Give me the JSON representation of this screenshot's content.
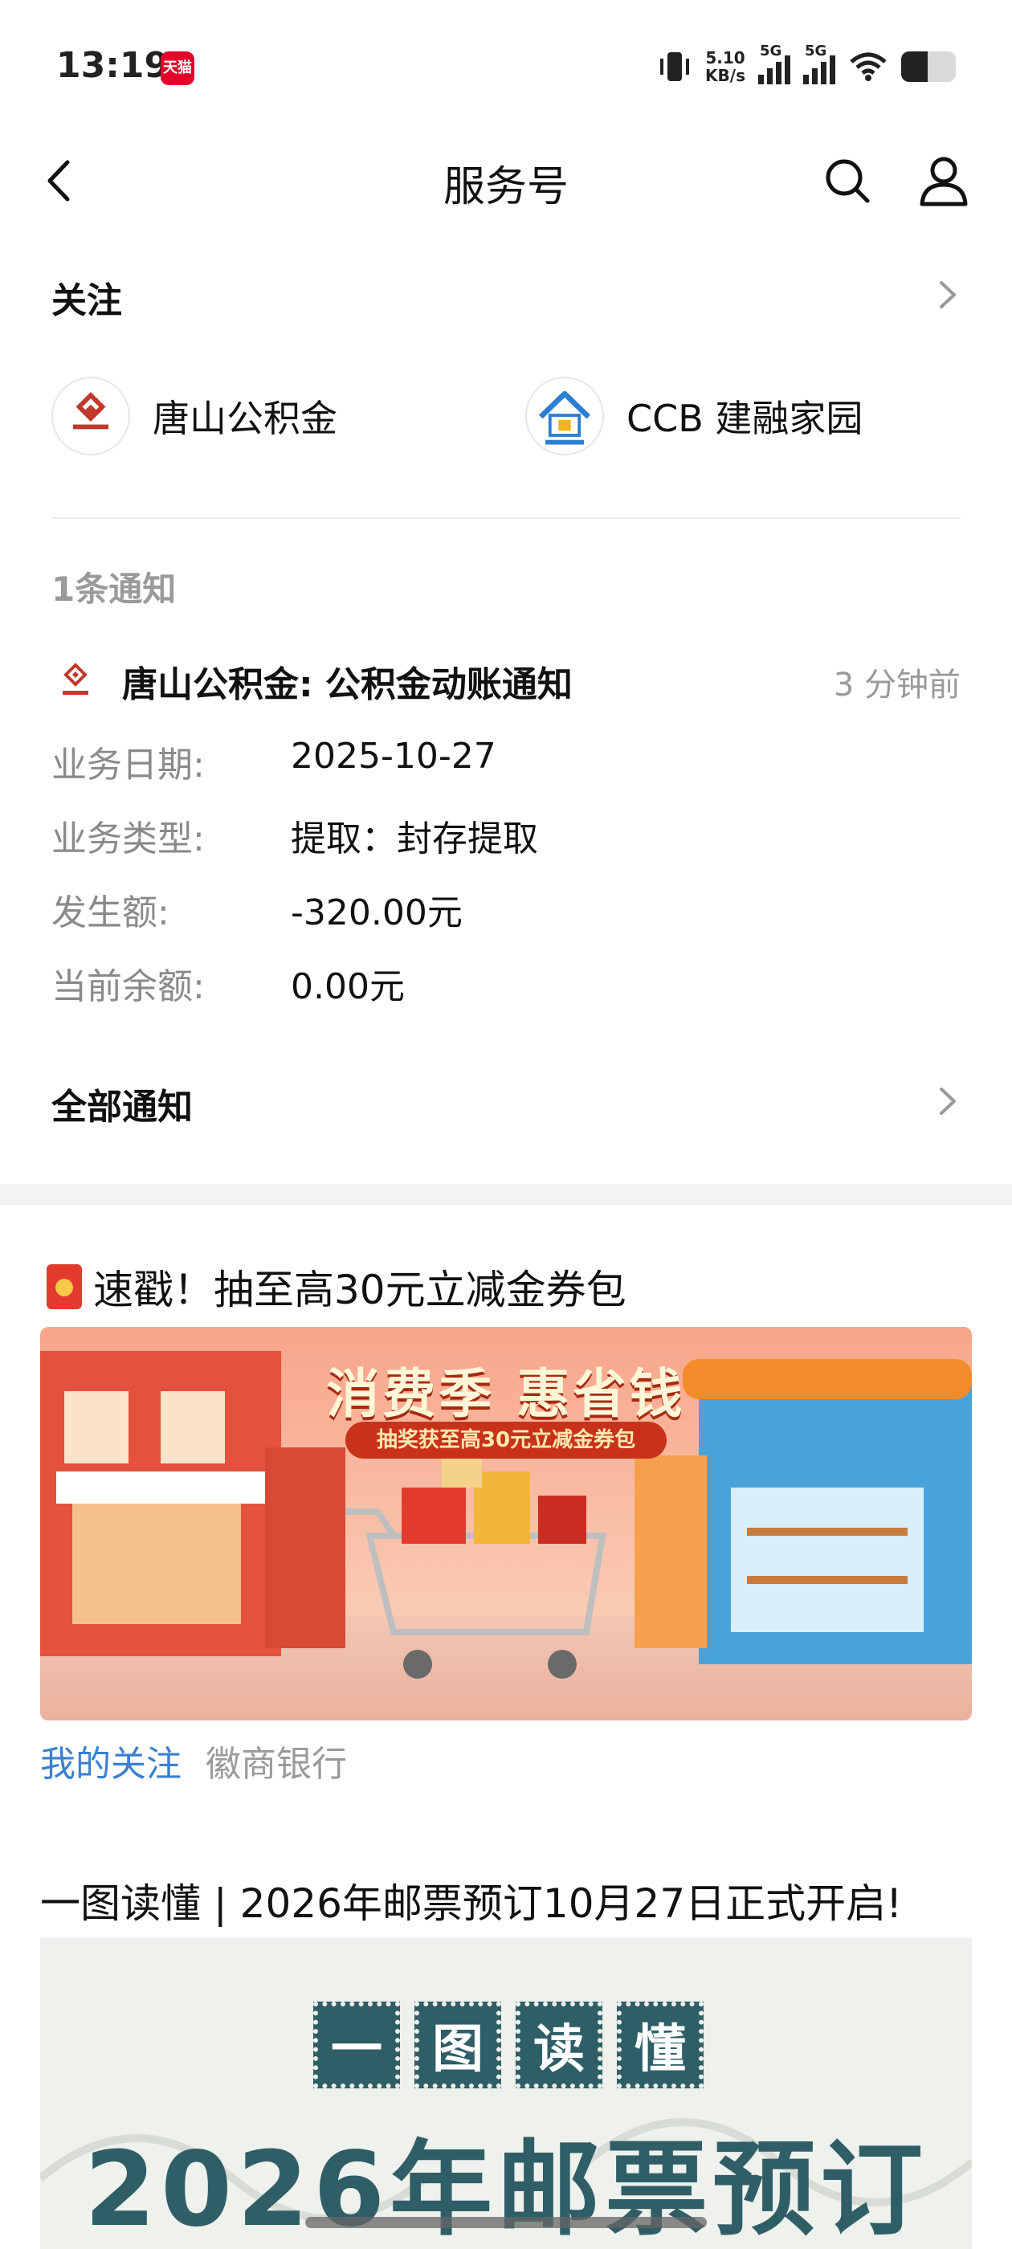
{
  "status_bar": {
    "time": "13:19",
    "app_badge": "天猫",
    "net_speed_value": "5.10",
    "net_speed_unit": "KB/s",
    "signal1_label": "5G",
    "signal2_label": "5G",
    "battery_level": 0.48
  },
  "header": {
    "title": "服务号"
  },
  "follow": {
    "heading": "关注",
    "accounts": [
      {
        "name": "唐山公积金"
      },
      {
        "name": "CCB 建融家园"
      }
    ]
  },
  "notifications": {
    "count_label": "1条通知",
    "item": {
      "title": "唐山公积金: 公积金动账通知",
      "time": "3 分钟前",
      "details": [
        {
          "label": "业务日期:",
          "value": "2025-10-27"
        },
        {
          "label": "业务类型:",
          "value": "提取：封存提取"
        },
        {
          "label": "发生额:",
          "value": "-320.00元"
        },
        {
          "label": "当前余额:",
          "value": "0.00元"
        }
      ]
    },
    "all_label": "全部通知"
  },
  "promo": {
    "title": "速戳！抽至高30元立减金券包",
    "banner_headline": "消费季 惠省钱",
    "banner_sub": "抽奖获至高30元立减金券包",
    "tags": [
      "我的关注",
      "徽商银行"
    ]
  },
  "article": {
    "title": "一图读懂 | 2026年邮票预订10月27日正式开启!",
    "stamps": [
      "一",
      "图",
      "读",
      "懂"
    ],
    "big_text": "2026年邮票预订"
  },
  "colors": {
    "accent_blue": "#3a7fd0",
    "muted_gray": "#9a9a9a",
    "banner_red": "#e8573f"
  }
}
